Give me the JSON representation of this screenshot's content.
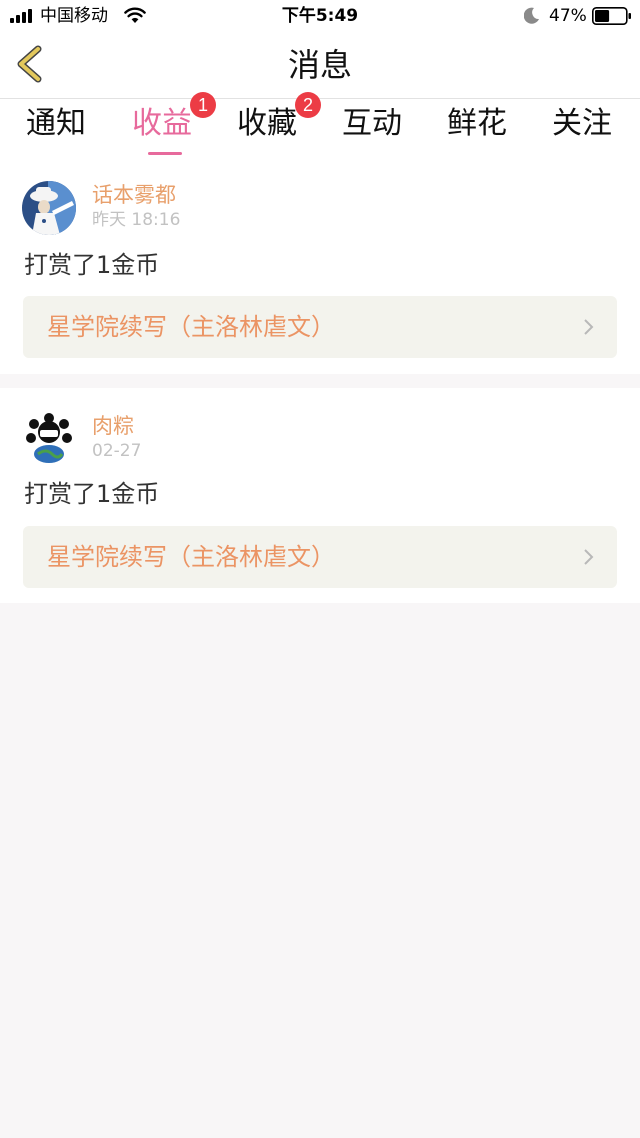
{
  "status_bar": {
    "carrier": "中国移动",
    "time": "下午5:49",
    "battery_percent": "47%",
    "battery_level": 0.47
  },
  "header": {
    "title": "消息"
  },
  "tabs": [
    {
      "label": "通知",
      "badge": null,
      "active": false
    },
    {
      "label": "收益",
      "badge": "1",
      "active": true
    },
    {
      "label": "收藏",
      "badge": "2",
      "active": false
    },
    {
      "label": "互动",
      "badge": null,
      "active": false
    },
    {
      "label": "鲜花",
      "badge": null,
      "active": false
    },
    {
      "label": "关注",
      "badge": null,
      "active": false
    }
  ],
  "messages": [
    {
      "username": "话本雾都",
      "time": "昨天 18:16",
      "text": "打赏了1金币",
      "link": "星学院续写（主洛林虐文）"
    },
    {
      "username": "肉粽",
      "time": "02-27",
      "text": "打赏了1金币",
      "link": "星学院续写（主洛林虐文）"
    }
  ],
  "colors": {
    "accent": "#e76a9c",
    "badge": "#ec3c45",
    "username": "#e8a06c",
    "link": "#eb9464",
    "link_bg": "#f3f3ed",
    "back_arrow": "#c8a23a",
    "page_bg": "#f8f6f7"
  }
}
